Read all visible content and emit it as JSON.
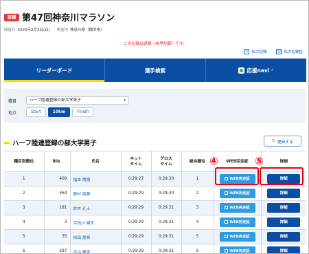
{
  "header": {
    "badge": "速報",
    "title": "第47回神奈川マラソン",
    "date_label": "開催日",
    "date": "2025年2月2日(日)",
    "venue_label": "開催地",
    "venue": "神奈川県（横浜市）"
  },
  "notice": "この記録は速報（参考記録）です。",
  "my_links": [
    "私の記録",
    "私の記録証"
  ],
  "nav": {
    "tabs": [
      "リーダーボード",
      "選手検索",
      "応援navi"
    ],
    "active": 0
  },
  "filter": {
    "category_label": "種目",
    "category_value": "ハーフ陸連登録の部大学男子",
    "point_label": "地点",
    "points": [
      "Start",
      "10km",
      "Finish"
    ],
    "selected_point": "10km"
  },
  "section": {
    "title": "ハーフ陸連登録の部大学男子",
    "refresh_label": "更新する"
  },
  "table": {
    "headers": [
      "種目別順位",
      "Bib.",
      "氏名",
      "ネット\nタイム",
      "グロス\nタイム",
      "総合順位",
      "WEB完走証",
      "詳細"
    ],
    "cert_label": "WEB完走証",
    "detail_label": "詳細",
    "rows": [
      {
        "rank": "1",
        "bib": "409",
        "name": "福本 陽樹",
        "net": "0:29:27",
        "gross": "0:29:30",
        "overall": "1"
      },
      {
        "rank": "2",
        "bib": "464",
        "name": "野村 昭夢",
        "net": "0:29:29",
        "gross": "0:29:30",
        "overall": "2"
      },
      {
        "rank": "3",
        "bib": "181",
        "name": "鈴木 孔士",
        "net": "0:29:29",
        "gross": "0:29:31",
        "overall": "3"
      },
      {
        "rank": "4",
        "bib": "3",
        "name": "宇田川 瞬矢",
        "net": "0:29:29",
        "gross": "0:29:31",
        "overall": "4"
      },
      {
        "rank": "5",
        "bib": "35",
        "name": "松田 煌希",
        "net": "0:29:29",
        "gross": "0:29:31",
        "overall": "5"
      },
      {
        "rank": "6",
        "bib": "297",
        "name": "平山 櫂吏",
        "net": "0:29:29",
        "gross": "0:29:31",
        "overall": "6"
      }
    ]
  },
  "annotations": {
    "marks": [
      "④",
      "⑤"
    ],
    "color": "#e60012"
  },
  "colors": {
    "primary": "#0a4fa3",
    "accent": "#ffd800",
    "cert_button": "#2f9be0",
    "badge": "#e5343a"
  }
}
